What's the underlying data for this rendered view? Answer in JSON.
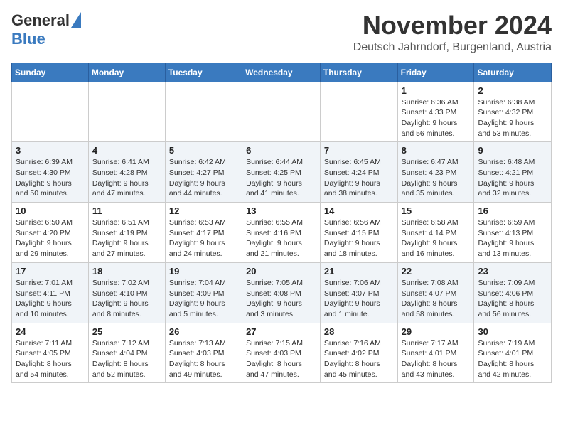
{
  "logo": {
    "general": "General",
    "blue": "Blue"
  },
  "header": {
    "month": "November 2024",
    "location": "Deutsch Jahrndorf, Burgenland, Austria"
  },
  "weekdays": [
    "Sunday",
    "Monday",
    "Tuesday",
    "Wednesday",
    "Thursday",
    "Friday",
    "Saturday"
  ],
  "weeks": [
    [
      {
        "day": "",
        "info": ""
      },
      {
        "day": "",
        "info": ""
      },
      {
        "day": "",
        "info": ""
      },
      {
        "day": "",
        "info": ""
      },
      {
        "day": "",
        "info": ""
      },
      {
        "day": "1",
        "info": "Sunrise: 6:36 AM\nSunset: 4:33 PM\nDaylight: 9 hours and 56 minutes."
      },
      {
        "day": "2",
        "info": "Sunrise: 6:38 AM\nSunset: 4:32 PM\nDaylight: 9 hours and 53 minutes."
      }
    ],
    [
      {
        "day": "3",
        "info": "Sunrise: 6:39 AM\nSunset: 4:30 PM\nDaylight: 9 hours and 50 minutes."
      },
      {
        "day": "4",
        "info": "Sunrise: 6:41 AM\nSunset: 4:28 PM\nDaylight: 9 hours and 47 minutes."
      },
      {
        "day": "5",
        "info": "Sunrise: 6:42 AM\nSunset: 4:27 PM\nDaylight: 9 hours and 44 minutes."
      },
      {
        "day": "6",
        "info": "Sunrise: 6:44 AM\nSunset: 4:25 PM\nDaylight: 9 hours and 41 minutes."
      },
      {
        "day": "7",
        "info": "Sunrise: 6:45 AM\nSunset: 4:24 PM\nDaylight: 9 hours and 38 minutes."
      },
      {
        "day": "8",
        "info": "Sunrise: 6:47 AM\nSunset: 4:23 PM\nDaylight: 9 hours and 35 minutes."
      },
      {
        "day": "9",
        "info": "Sunrise: 6:48 AM\nSunset: 4:21 PM\nDaylight: 9 hours and 32 minutes."
      }
    ],
    [
      {
        "day": "10",
        "info": "Sunrise: 6:50 AM\nSunset: 4:20 PM\nDaylight: 9 hours and 29 minutes."
      },
      {
        "day": "11",
        "info": "Sunrise: 6:51 AM\nSunset: 4:19 PM\nDaylight: 9 hours and 27 minutes."
      },
      {
        "day": "12",
        "info": "Sunrise: 6:53 AM\nSunset: 4:17 PM\nDaylight: 9 hours and 24 minutes."
      },
      {
        "day": "13",
        "info": "Sunrise: 6:55 AM\nSunset: 4:16 PM\nDaylight: 9 hours and 21 minutes."
      },
      {
        "day": "14",
        "info": "Sunrise: 6:56 AM\nSunset: 4:15 PM\nDaylight: 9 hours and 18 minutes."
      },
      {
        "day": "15",
        "info": "Sunrise: 6:58 AM\nSunset: 4:14 PM\nDaylight: 9 hours and 16 minutes."
      },
      {
        "day": "16",
        "info": "Sunrise: 6:59 AM\nSunset: 4:13 PM\nDaylight: 9 hours and 13 minutes."
      }
    ],
    [
      {
        "day": "17",
        "info": "Sunrise: 7:01 AM\nSunset: 4:11 PM\nDaylight: 9 hours and 10 minutes."
      },
      {
        "day": "18",
        "info": "Sunrise: 7:02 AM\nSunset: 4:10 PM\nDaylight: 9 hours and 8 minutes."
      },
      {
        "day": "19",
        "info": "Sunrise: 7:04 AM\nSunset: 4:09 PM\nDaylight: 9 hours and 5 minutes."
      },
      {
        "day": "20",
        "info": "Sunrise: 7:05 AM\nSunset: 4:08 PM\nDaylight: 9 hours and 3 minutes."
      },
      {
        "day": "21",
        "info": "Sunrise: 7:06 AM\nSunset: 4:07 PM\nDaylight: 9 hours and 1 minute."
      },
      {
        "day": "22",
        "info": "Sunrise: 7:08 AM\nSunset: 4:07 PM\nDaylight: 8 hours and 58 minutes."
      },
      {
        "day": "23",
        "info": "Sunrise: 7:09 AM\nSunset: 4:06 PM\nDaylight: 8 hours and 56 minutes."
      }
    ],
    [
      {
        "day": "24",
        "info": "Sunrise: 7:11 AM\nSunset: 4:05 PM\nDaylight: 8 hours and 54 minutes."
      },
      {
        "day": "25",
        "info": "Sunrise: 7:12 AM\nSunset: 4:04 PM\nDaylight: 8 hours and 52 minutes."
      },
      {
        "day": "26",
        "info": "Sunrise: 7:13 AM\nSunset: 4:03 PM\nDaylight: 8 hours and 49 minutes."
      },
      {
        "day": "27",
        "info": "Sunrise: 7:15 AM\nSunset: 4:03 PM\nDaylight: 8 hours and 47 minutes."
      },
      {
        "day": "28",
        "info": "Sunrise: 7:16 AM\nSunset: 4:02 PM\nDaylight: 8 hours and 45 minutes."
      },
      {
        "day": "29",
        "info": "Sunrise: 7:17 AM\nSunset: 4:01 PM\nDaylight: 8 hours and 43 minutes."
      },
      {
        "day": "30",
        "info": "Sunrise: 7:19 AM\nSunset: 4:01 PM\nDaylight: 8 hours and 42 minutes."
      }
    ]
  ]
}
